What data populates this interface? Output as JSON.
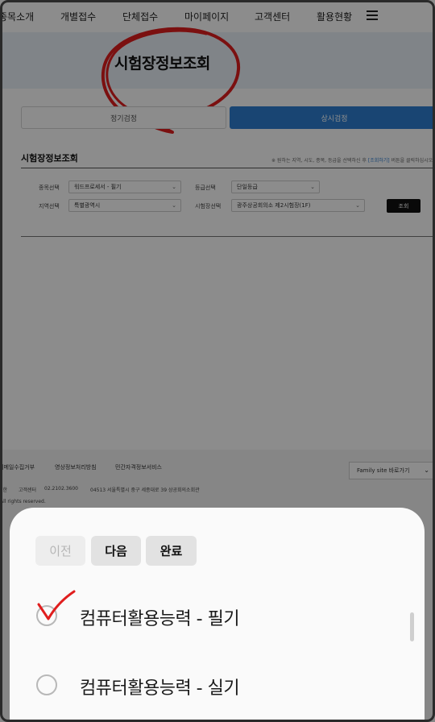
{
  "nav": {
    "items": [
      "종목소개",
      "개별접수",
      "단체접수",
      "마이페이지",
      "고객센터",
      "활용현황"
    ]
  },
  "hero": {
    "title": "시험장정보조회"
  },
  "tabs": {
    "regular": "정기검정",
    "anytime": "상시검정"
  },
  "section": {
    "title": "시험장정보조회",
    "note_prefix": "※ 원하는 지역, 시도, 종목, 등급을 선택하신 후",
    "note_link": "[조회하기]",
    "note_suffix": "버튼을 클릭하십시오"
  },
  "form": {
    "subject_label": "종목선택",
    "subject_value": "워드프로세서 - 필기",
    "grade_label": "등급선택",
    "grade_value": "단일등급",
    "region_label": "지역선택",
    "region_value": "특별광역시",
    "site_label": "시험장선택",
    "site_value": "광주상공회의소 제2시험장(1F)",
    "search_button": "조회"
  },
  "footer": {
    "links": [
      "이메일수집거부",
      "영상정보처리방침",
      "민간자격정보서비스"
    ],
    "family_site": "Family site 바로가기",
    "info_org": "대한",
    "info_center_label": "고객센터",
    "info_phone": "02.2102.3600",
    "info_address": "04513 서울특별시 중구 세종대로 39 상공회의소회관",
    "copyright": "All rights reserved."
  },
  "picker": {
    "prev_label": "이전",
    "next_label": "다음",
    "done_label": "완료",
    "options": [
      "컴퓨터활용능력 - 필기",
      "컴퓨터활용능력 - 실기"
    ]
  },
  "colors": {
    "accent": "#2f7fd1",
    "annotation": "#e01e1e",
    "overlay": "rgba(0,0,0,0.45)"
  }
}
